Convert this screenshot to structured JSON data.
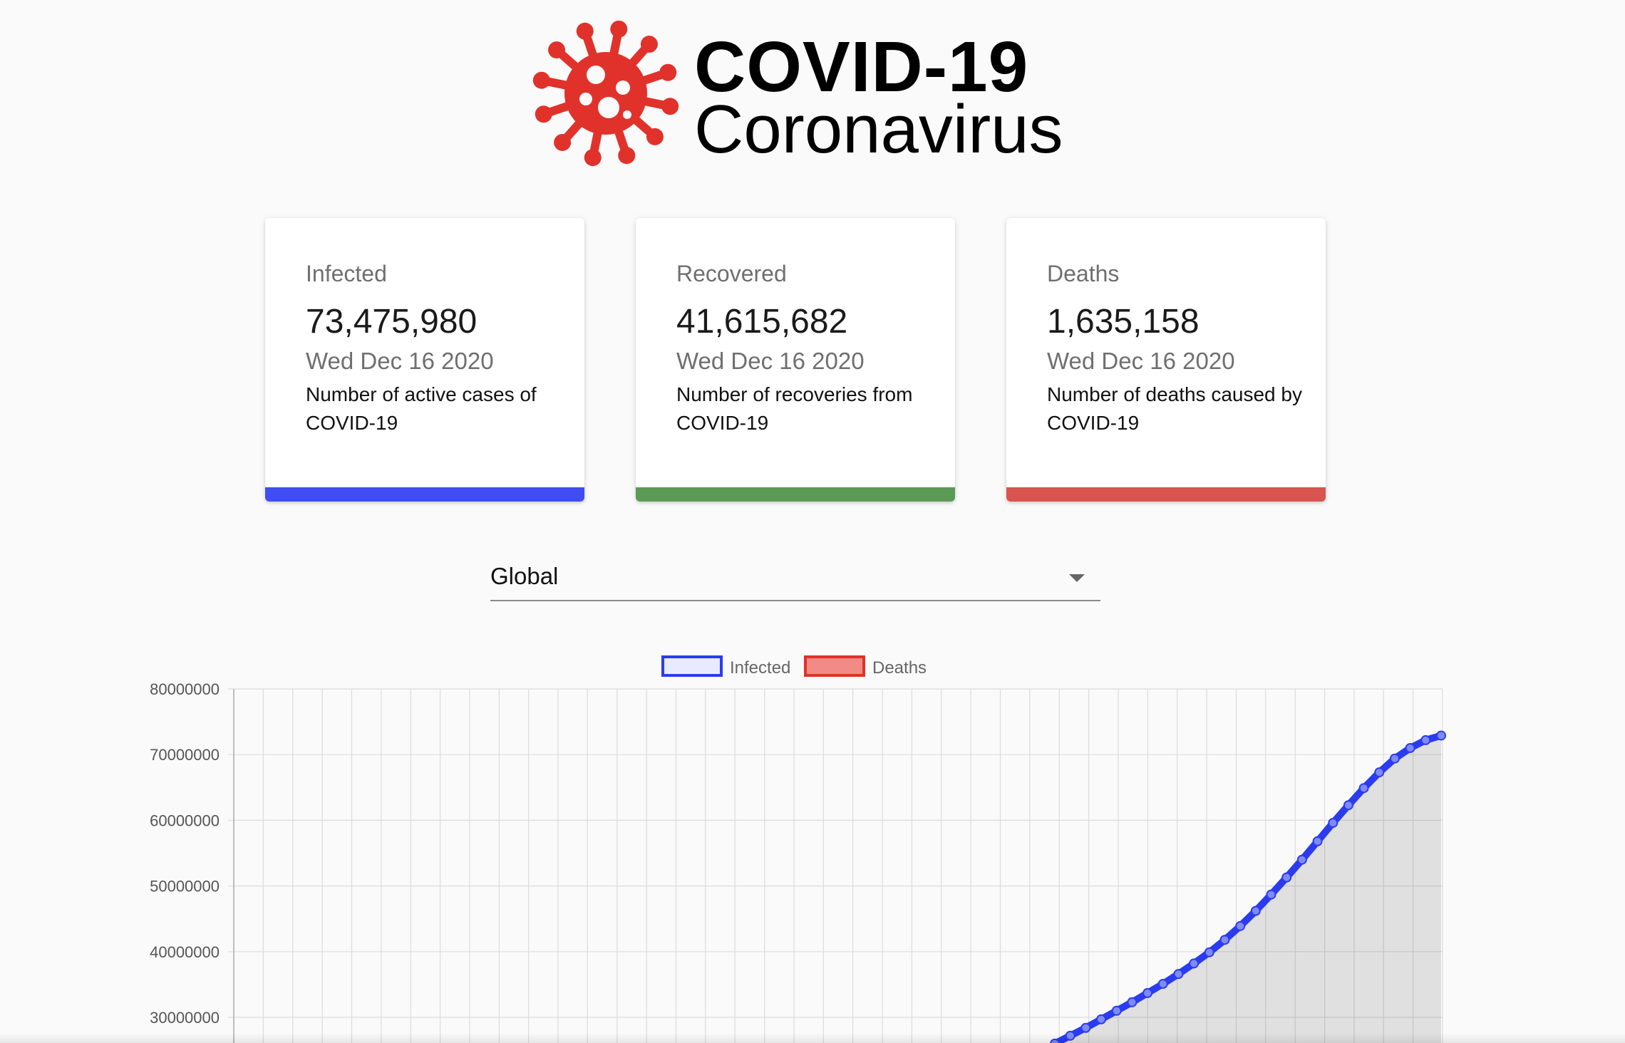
{
  "header": {
    "title": "COVID-19",
    "subtitle": "Coronavirus",
    "logo_icon": "virus-icon",
    "logo_color": "#e0322b"
  },
  "cards": [
    {
      "title": "Infected",
      "value": "73,475,980",
      "date": "Wed Dec 16 2020",
      "description": "Number of active cases of COVID-19",
      "accent": "#3f4df2"
    },
    {
      "title": "Recovered",
      "value": "41,615,682",
      "date": "Wed Dec 16 2020",
      "description": "Number of recoveries from COVID-19",
      "accent": "#5b9a55"
    },
    {
      "title": "Deaths",
      "value": "1,635,158",
      "date": "Wed Dec 16 2020",
      "description": "Number of deaths caused by COVID-19",
      "accent": "#d9534f"
    }
  ],
  "country_select": {
    "value": "Global"
  },
  "chart_data": {
    "type": "line",
    "legend": [
      {
        "label": "Infected",
        "stroke": "#2b3cf0",
        "fill": "#e8eaff"
      },
      {
        "label": "Deaths",
        "stroke": "#e0322b",
        "fill": "#f28a85"
      }
    ],
    "legend_position": "top",
    "y_ticks": [
      "80000000",
      "70000000",
      "60000000",
      "50000000",
      "40000000",
      "30000000"
    ],
    "ylim": [
      30000000,
      80000000
    ],
    "grid": true,
    "series": [
      {
        "name": "Infected",
        "color": "#2b3cf0",
        "values": [
          26000000,
          27200000,
          28400000,
          29700000,
          31000000,
          32300000,
          33700000,
          35100000,
          36600000,
          38200000,
          39900000,
          41800000,
          43900000,
          46200000,
          48700000,
          51300000,
          54000000,
          56800000,
          59600000,
          62300000,
          64900000,
          67300000,
          69400000,
          71000000,
          72200000,
          72900000
        ]
      }
    ]
  }
}
